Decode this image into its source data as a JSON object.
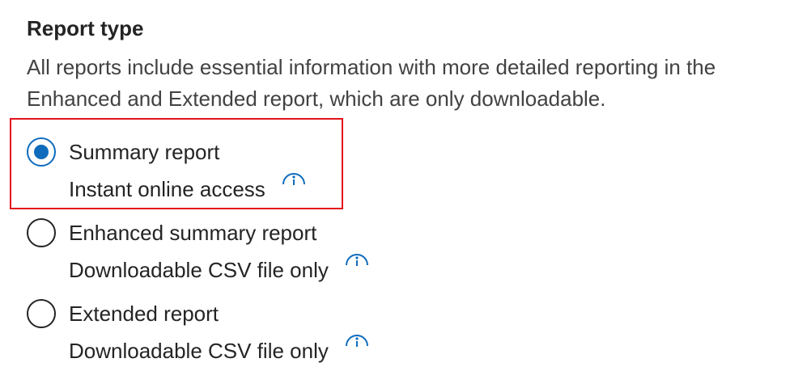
{
  "report_type": {
    "title": "Report type",
    "description": "All reports include essential information with more detailed reporting in the Enhanced and Extended report, which are only downloadable.",
    "options": [
      {
        "label": "Summary report",
        "sublabel": "Instant online access",
        "selected": true
      },
      {
        "label": "Enhanced summary report",
        "sublabel": "Downloadable CSV file only",
        "selected": false
      },
      {
        "label": "Extended report",
        "sublabel": "Downloadable CSV file only",
        "selected": false
      }
    ],
    "icons": {
      "info": "info-icon"
    }
  },
  "colors": {
    "accent": "#0f6cbd",
    "highlight": "#e3121a",
    "text": "#242424"
  }
}
